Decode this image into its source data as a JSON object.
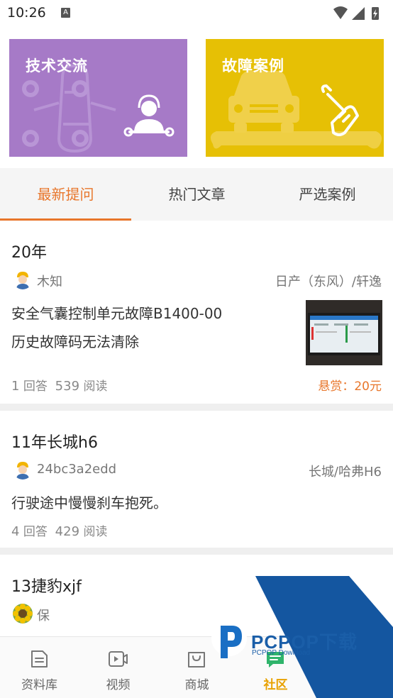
{
  "status_bar": {
    "time": "10:26",
    "a_badge": "A"
  },
  "banners": [
    {
      "title": "技术交流",
      "color": "#a67ac7"
    },
    {
      "title": "故障案例",
      "color": "#e6c005"
    }
  ],
  "tabs": [
    {
      "label": "最新提问",
      "active": true
    },
    {
      "label": "热门文章",
      "active": false
    },
    {
      "label": "严选案例",
      "active": false
    }
  ],
  "questions": [
    {
      "title": "20年",
      "author": "木知",
      "car": "日产（东风）/轩逸",
      "lines": [
        "安全气囊控制单元故障B1400-00",
        "历史故障码无法清除"
      ],
      "answers_num": "1",
      "answers_label": "回答",
      "reads_num": "539",
      "reads_label": "阅读",
      "reward": "悬赏：20元"
    },
    {
      "title": "11年长城h6",
      "author": "24bc3a2edd",
      "car": "长城/哈弗H6",
      "lines": [
        "行驶途中慢慢刹车抱死。"
      ],
      "answers_num": "4",
      "answers_label": "回答",
      "reads_num": "429",
      "reads_label": "阅读"
    },
    {
      "title": "13捷豹xjf",
      "author": "保"
    }
  ],
  "bottom_nav": [
    {
      "label": "资料库",
      "icon": "document-icon"
    },
    {
      "label": "视频",
      "icon": "video-icon"
    },
    {
      "label": "商城",
      "icon": "shopping-bag-icon"
    },
    {
      "label": "社区",
      "icon": "community-chat-icon",
      "active": true
    }
  ],
  "watermark": {
    "text": "PCPOP下载",
    "sub": "PCPOP Download"
  },
  "colors": {
    "accent": "#e8762b",
    "nav_active": "#e8a100",
    "tech_banner": "#a67ac7",
    "fault_banner": "#e6c005"
  }
}
